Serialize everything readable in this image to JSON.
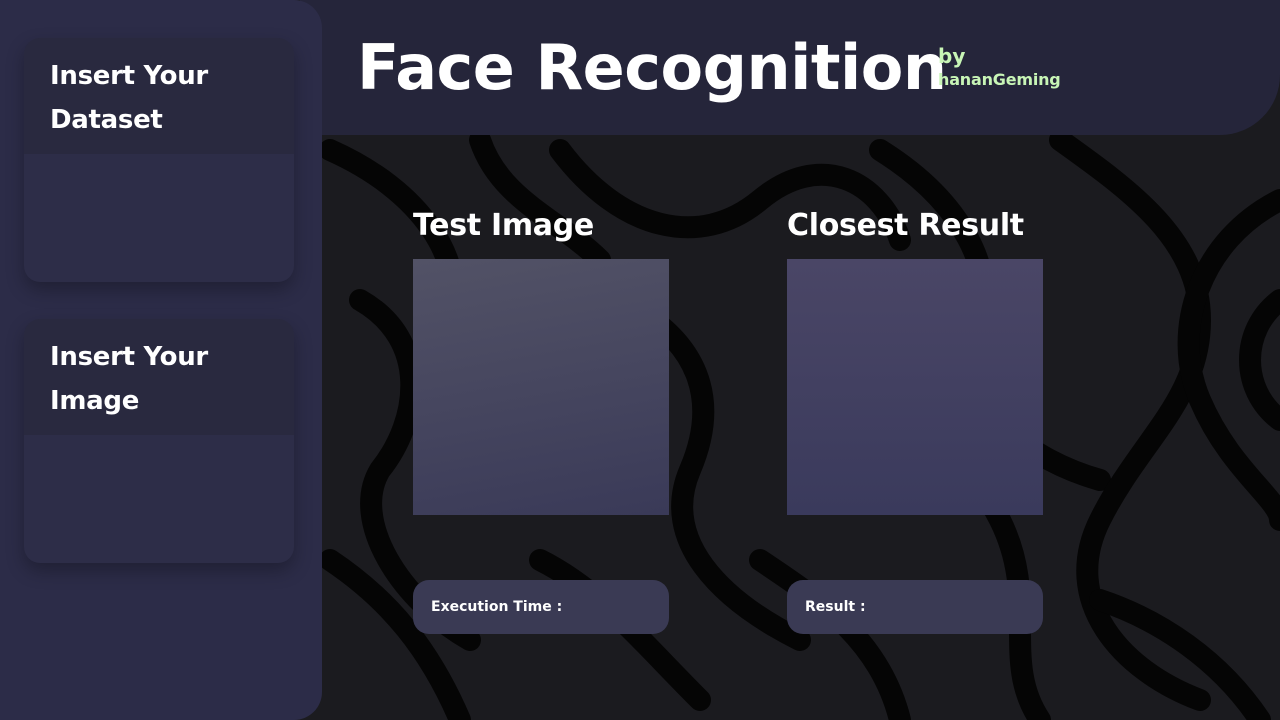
{
  "header": {
    "title": "Face Recognition",
    "by": "by",
    "author": "hananGeming"
  },
  "sidebar": {
    "dataset_card": {
      "title": "Insert Your Dataset"
    },
    "image_card": {
      "title": "Insert Your Image"
    }
  },
  "main": {
    "test_image": {
      "title": "Test Image"
    },
    "closest_result": {
      "title": "Closest Result"
    },
    "execution_time": {
      "label": "Execution Time :"
    },
    "result": {
      "label": "Result :"
    }
  },
  "colors": {
    "background": "#1b1b1f",
    "header": "#25253a",
    "sidebar": "#2c2c48",
    "accent_green": "#c8f5b6",
    "pill": "#3a3a54"
  }
}
